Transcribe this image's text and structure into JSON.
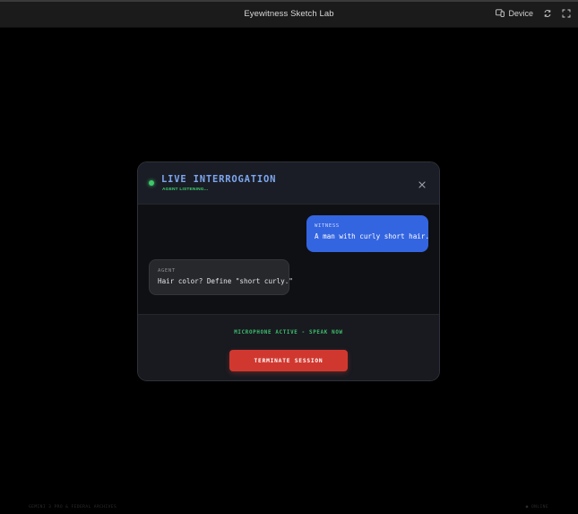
{
  "window": {
    "title": "Eyewitness Sketch Lab",
    "device_label": "Device",
    "icons": {
      "device": "device-icon",
      "rotate": "rotate-icon",
      "fullscreen": "fullscreen-icon"
    }
  },
  "footer": {
    "left_text": "GEMINI 3 PRO & FEDERAL ARCHIVES",
    "right_text": "● ONLINE"
  },
  "modal": {
    "title": "LIVE INTERROGATION",
    "status": "AGENT LISTENING...",
    "status_color": "#3fcf72",
    "messages": [
      {
        "role": "WITNESS",
        "text": "A man with curly short hair.",
        "color": "#3465e0"
      },
      {
        "role": "AGENT",
        "text": "Hair color? Define \"short curly.\"",
        "color": "#27282c"
      }
    ],
    "mic_status": "MICROPHONE ACTIVE - SPEAK NOW",
    "terminate_label": "TERMINATE SESSION",
    "terminate_color": "#d0382f",
    "accent_color": "#7ea6f0"
  }
}
